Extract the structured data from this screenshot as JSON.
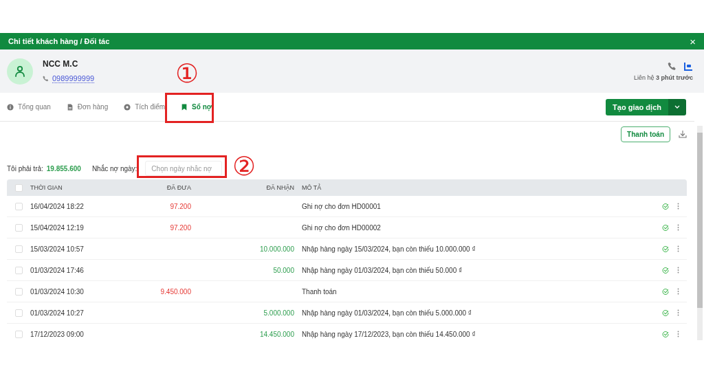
{
  "window": {
    "title": "Chi tiết khách hàng / Đối tác",
    "close": "×"
  },
  "contact": {
    "name": "NCC M.C",
    "phone": "0989999999",
    "last_contact": "Liên hệ **3 phút trước**"
  },
  "tabs": [
    {
      "label": "Tổng quan",
      "selected": false
    },
    {
      "label": "Đơn hàng",
      "selected": false
    },
    {
      "label": "Tích điểm",
      "selected": false
    },
    {
      "label": "Sổ nợ",
      "selected": true
    }
  ],
  "create_button": {
    "label": "Tạo giao dịch"
  },
  "pay_button": {
    "label": "Thanh toán"
  },
  "summary": {
    "label": "Tôi phải trả:",
    "amount": "19.855.600",
    "reminder_label": "Nhắc nợ ngày:",
    "reminder_placeholder": "Chọn ngày nhắc nợ"
  },
  "table": {
    "columns": [
      "THỜI GIAN",
      "ĐÃ ĐƯA",
      "ĐÃ NHẬN",
      "MÔ TẢ"
    ],
    "all_checked": false,
    "rows": [
      {
        "checked": false,
        "time": "16/04/2024 18:22",
        "paid": "97.200",
        "received": "",
        "description": "Ghi nợ cho đơn HD00001"
      },
      {
        "checked": false,
        "time": "15/04/2024 12:19",
        "paid": "97.200",
        "received": "",
        "description": "Ghi nợ cho đơn HD00002"
      },
      {
        "checked": false,
        "time": "15/03/2024 10:57",
        "paid": "",
        "received": "10.000.000",
        "description": "Nhập hàng ngày 15/03/2024, bạn còn thiếu 10.000.000 ₫"
      },
      {
        "checked": false,
        "time": "01/03/2024 17:46",
        "paid": "",
        "received": "50.000",
        "description": "Nhập hàng ngày 01/03/2024, bạn còn thiếu 50.000 ₫"
      },
      {
        "checked": false,
        "time": "01/03/2024 10:30",
        "paid": "9.450.000",
        "received": "",
        "description": "Thanh toán"
      },
      {
        "checked": false,
        "time": "01/03/2024 10:27",
        "paid": "",
        "received": "5.000.000",
        "description": "Nhập hàng ngày 01/03/2024, bạn còn thiếu 5.000.000 ₫"
      },
      {
        "checked": false,
        "time": "17/12/2023 09:00",
        "paid": "",
        "received": "14.450.000",
        "description": "Nhập hàng ngày 17/12/2023, bạn còn thiếu 14.450.000 ₫"
      }
    ]
  },
  "annotations": [
    {
      "number": "①"
    },
    {
      "number": "②"
    }
  ]
}
